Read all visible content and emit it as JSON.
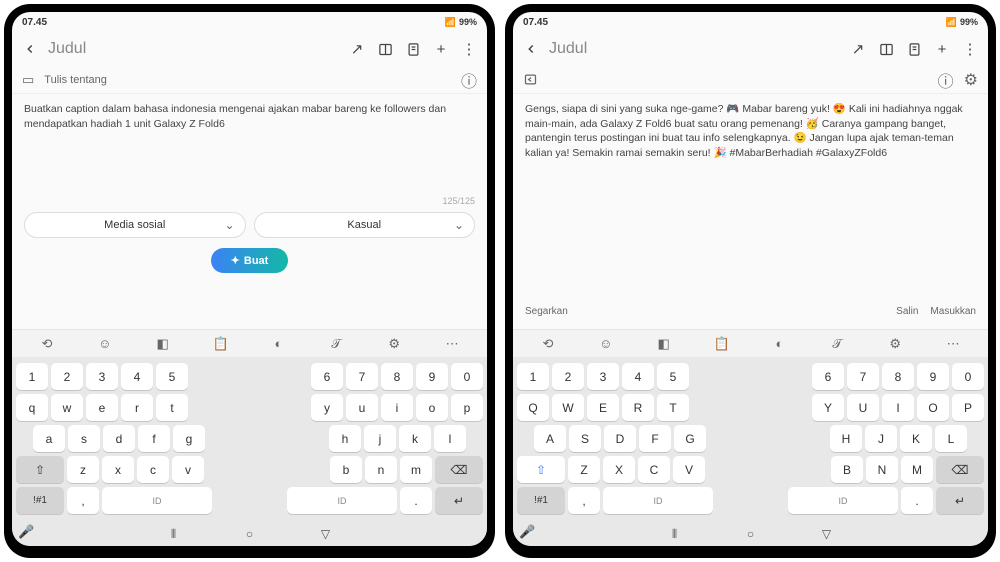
{
  "status": {
    "time": "07.45",
    "battery": "99%"
  },
  "header": {
    "title": "Judul"
  },
  "left": {
    "placeholder": "Tulis tentang",
    "text": "Buatkan caption dalam bahasa indonesia mengenai ajakan mabar bareng ke followers dan mendapatkan hadiah 1 unit Galaxy Z Fold6",
    "counter": "125/125",
    "selectors": {
      "media": "Media sosial",
      "tone": "Kasual"
    },
    "create": "Buat"
  },
  "right": {
    "text": "Gengs, siapa di sini yang suka nge-game? 🎮  Mabar bareng yuk! 😍 Kali ini hadiahnya nggak main-main, ada Galaxy Z Fold6 buat satu orang pemenang! 🥳 Caranya gampang banget, pantengin terus postingan ini buat tau info selengkapnya. 😉 Jangan lupa ajak teman-teman kalian ya!  Semakin ramai semakin seru! 🎉 #MabarBerhadiah #GalaxyZFold6",
    "actions": {
      "refresh": "Segarkan",
      "copy": "Salin",
      "insert": "Masukkan"
    }
  },
  "keyboard": {
    "numRow": [
      "1",
      "2",
      "3",
      "4",
      "5",
      "6",
      "7",
      "8",
      "9",
      "0"
    ],
    "row1_lower": [
      "q",
      "w",
      "e",
      "r",
      "t",
      "y",
      "u",
      "i",
      "o",
      "p"
    ],
    "row1_upper": [
      "Q",
      "W",
      "E",
      "R",
      "T",
      "Y",
      "U",
      "I",
      "O",
      "P"
    ],
    "row2_lower": [
      "a",
      "s",
      "d",
      "f",
      "g",
      "h",
      "j",
      "k",
      "l"
    ],
    "row2_upper": [
      "A",
      "S",
      "D",
      "F",
      "G",
      "H",
      "J",
      "K",
      "L"
    ],
    "row3_lower": [
      "z",
      "x",
      "c",
      "v",
      "b",
      "n",
      "m"
    ],
    "row3_upper": [
      "Z",
      "X",
      "C",
      "V",
      "B",
      "N",
      "M"
    ],
    "symKey": "!#1",
    "comma": ",",
    "period": ".",
    "space": "ID"
  }
}
